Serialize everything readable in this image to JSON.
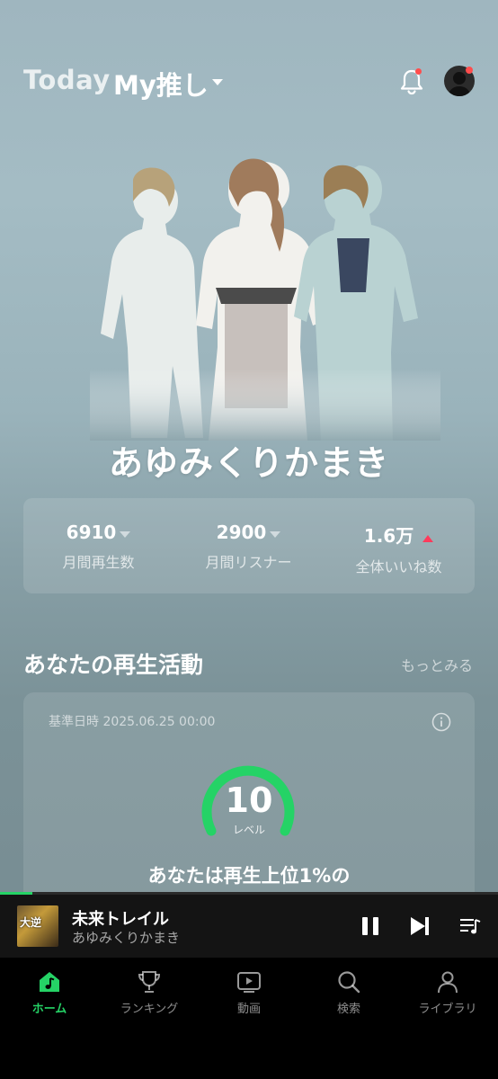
{
  "header": {
    "tab_today": "Today",
    "tab_myoshi": "My推し"
  },
  "artist": {
    "name": "あゆみくりかまき"
  },
  "stats": [
    {
      "value": "6910",
      "label": "月間再生数",
      "trend": "down"
    },
    {
      "value": "2900",
      "label": "月間リスナー",
      "trend": "down"
    },
    {
      "value": "1.6万",
      "label": "全体いいね数",
      "trend": "up"
    }
  ],
  "activity": {
    "title": "あなたの再生活動",
    "more": "もっとみる",
    "base_date": "基準日時 2025.06.25 00:00",
    "level": "10",
    "level_label": "レベル",
    "rank_text": "あなたは再生上位1%の"
  },
  "player": {
    "song_title": "未来トレイル",
    "artist": "あゆみくりかまき",
    "album_art_text": "大逆",
    "progress": 0.065
  },
  "nav": [
    {
      "label": "ホーム",
      "icon": "home-music-icon",
      "active": true
    },
    {
      "label": "ランキング",
      "icon": "trophy-icon",
      "active": false
    },
    {
      "label": "動画",
      "icon": "video-icon",
      "active": false
    },
    {
      "label": "検索",
      "icon": "search-icon",
      "active": false
    },
    {
      "label": "ライブラリ",
      "icon": "person-icon",
      "active": false
    }
  ],
  "colors": {
    "accent": "#25d366",
    "trend_up": "#ff3b5c",
    "notification_dot": "#ff4d4d"
  }
}
